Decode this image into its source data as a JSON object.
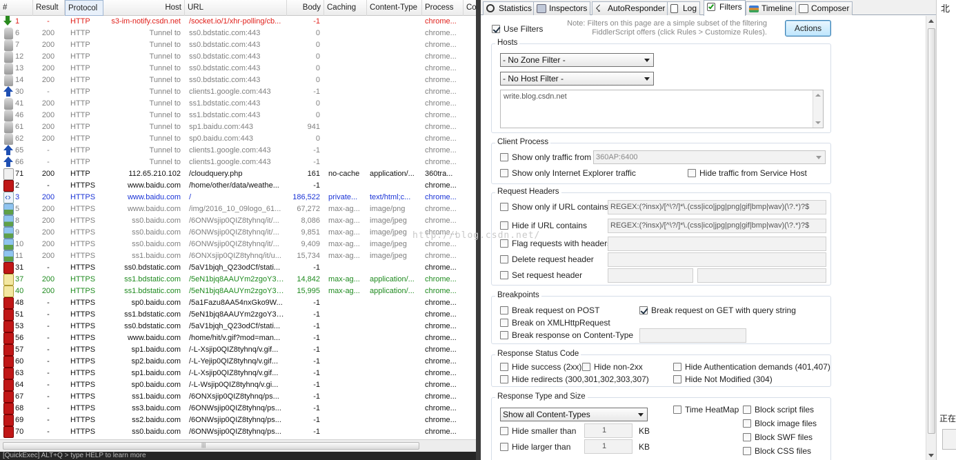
{
  "sessions": {
    "columns": {
      "num": "#",
      "result": "Result",
      "protocol": "Protocol",
      "host": "Host",
      "url": "URL",
      "body": "Body",
      "caching": "Caching",
      "content_type": "Content-Type",
      "process": "Process",
      "comments": "Co"
    },
    "rows": [
      {
        "icon": "arrowdown",
        "num": "1",
        "result": "-",
        "protocol": "HTTP",
        "host": "s3-im-notify.csdn.net",
        "url": "/socket.io/1/xhr-polling/cb...",
        "body": "-1",
        "caching": "",
        "ct": "",
        "process": "chrome...",
        "color": "red"
      },
      {
        "icon": "lock",
        "num": "6",
        "result": "200",
        "protocol": "HTTP",
        "host": "Tunnel to",
        "url": "ss0.bdstatic.com:443",
        "body": "0",
        "caching": "",
        "ct": "",
        "process": "chrome...",
        "color": "gray"
      },
      {
        "icon": "lock",
        "num": "7",
        "result": "200",
        "protocol": "HTTP",
        "host": "Tunnel to",
        "url": "ss0.bdstatic.com:443",
        "body": "0",
        "caching": "",
        "ct": "",
        "process": "chrome...",
        "color": "gray"
      },
      {
        "icon": "lock",
        "num": "12",
        "result": "200",
        "protocol": "HTTP",
        "host": "Tunnel to",
        "url": "ss0.bdstatic.com:443",
        "body": "0",
        "caching": "",
        "ct": "",
        "process": "chrome...",
        "color": "gray"
      },
      {
        "icon": "lock",
        "num": "13",
        "result": "200",
        "protocol": "HTTP",
        "host": "Tunnel to",
        "url": "ss0.bdstatic.com:443",
        "body": "0",
        "caching": "",
        "ct": "",
        "process": "chrome...",
        "color": "gray"
      },
      {
        "icon": "lock",
        "num": "14",
        "result": "200",
        "protocol": "HTTP",
        "host": "Tunnel to",
        "url": "ss0.bdstatic.com:443",
        "body": "0",
        "caching": "",
        "ct": "",
        "process": "chrome...",
        "color": "gray"
      },
      {
        "icon": "arrowup",
        "num": "30",
        "result": "-",
        "protocol": "HTTP",
        "host": "Tunnel to",
        "url": "clients1.google.com:443",
        "body": "-1",
        "caching": "",
        "ct": "",
        "process": "chrome...",
        "color": "gray"
      },
      {
        "icon": "lock",
        "num": "41",
        "result": "200",
        "protocol": "HTTP",
        "host": "Tunnel to",
        "url": "ss1.bdstatic.com:443",
        "body": "0",
        "caching": "",
        "ct": "",
        "process": "chrome...",
        "color": "gray"
      },
      {
        "icon": "lock",
        "num": "46",
        "result": "200",
        "protocol": "HTTP",
        "host": "Tunnel to",
        "url": "ss1.bdstatic.com:443",
        "body": "0",
        "caching": "",
        "ct": "",
        "process": "chrome...",
        "color": "gray"
      },
      {
        "icon": "lock",
        "num": "61",
        "result": "200",
        "protocol": "HTTP",
        "host": "Tunnel to",
        "url": "sp1.baidu.com:443",
        "body": "941",
        "caching": "",
        "ct": "",
        "process": "chrome...",
        "color": "gray"
      },
      {
        "icon": "lock",
        "num": "62",
        "result": "200",
        "protocol": "HTTP",
        "host": "Tunnel to",
        "url": "sp0.baidu.com:443",
        "body": "0",
        "caching": "",
        "ct": "",
        "process": "chrome...",
        "color": "gray"
      },
      {
        "icon": "arrowup",
        "num": "65",
        "result": "-",
        "protocol": "HTTP",
        "host": "Tunnel to",
        "url": "clients1.google.com:443",
        "body": "-1",
        "caching": "",
        "ct": "",
        "process": "chrome...",
        "color": "gray"
      },
      {
        "icon": "arrowup",
        "num": "66",
        "result": "-",
        "protocol": "HTTP",
        "host": "Tunnel to",
        "url": "clients1.google.com:443",
        "body": "-1",
        "caching": "",
        "ct": "",
        "process": "chrome...",
        "color": "gray"
      },
      {
        "icon": "json",
        "num": "71",
        "result": "200",
        "protocol": "HTTP",
        "host": "112.65.210.102",
        "url": "/cloudquery.php",
        "body": "161",
        "caching": "no-cache",
        "ct": "application/...",
        "process": "360tra...",
        "color": "black"
      },
      {
        "icon": "redx",
        "num": "2",
        "result": "-",
        "protocol": "HTTPS",
        "host": "www.baidu.com",
        "url": "/home/other/data/weathe...",
        "body": "-1",
        "caching": "",
        "ct": "",
        "process": "chrome...",
        "color": "black"
      },
      {
        "icon": "html",
        "num": "3",
        "result": "200",
        "protocol": "HTTPS",
        "host": "www.baidu.com",
        "url": "/",
        "body": "186,522",
        "caching": "private...",
        "ct": "text/html;c...",
        "process": "chrome...",
        "color": "blue"
      },
      {
        "icon": "image",
        "num": "5",
        "result": "200",
        "protocol": "HTTPS",
        "host": "www.baidu.com",
        "url": "/img/2016_10_09logo_61...",
        "body": "67,272",
        "caching": "max-ag...",
        "ct": "image/png",
        "process": "chrome...",
        "color": "gray"
      },
      {
        "icon": "image",
        "num": "8",
        "result": "200",
        "protocol": "HTTPS",
        "host": "ss0.baidu.com",
        "url": "/6ONWsjip0QIZ8tyhnq/it/...",
        "body": "8,086",
        "caching": "max-ag...",
        "ct": "image/jpeg",
        "process": "chrome...",
        "color": "gray"
      },
      {
        "icon": "image",
        "num": "9",
        "result": "200",
        "protocol": "HTTPS",
        "host": "ss0.baidu.com",
        "url": "/6ONWsjip0QIZ8tyhnq/it/...",
        "body": "9,851",
        "caching": "max-ag...",
        "ct": "image/jpeg",
        "process": "chrome...",
        "color": "gray"
      },
      {
        "icon": "image",
        "num": "10",
        "result": "200",
        "protocol": "HTTPS",
        "host": "ss0.baidu.com",
        "url": "/6ONWsjip0QIZ8tyhnq/it/...",
        "body": "9,409",
        "caching": "max-ag...",
        "ct": "image/jpeg",
        "process": "chrome...",
        "color": "gray"
      },
      {
        "icon": "image",
        "num": "11",
        "result": "200",
        "protocol": "HTTPS",
        "host": "ss1.baidu.com",
        "url": "/6ONXsjip0QIZ8tyhnq/it/u...",
        "body": "15,734",
        "caching": "max-ag...",
        "ct": "image/jpeg",
        "process": "chrome...",
        "color": "gray"
      },
      {
        "icon": "redx",
        "num": "31",
        "result": "-",
        "protocol": "HTTPS",
        "host": "ss0.bdstatic.com",
        "url": "/5aV1bjqh_Q23odCf/stati...",
        "body": "-1",
        "caching": "",
        "ct": "",
        "process": "chrome...",
        "color": "black"
      },
      {
        "icon": "script",
        "num": "37",
        "result": "200",
        "protocol": "HTTPS",
        "host": "ss1.bdstatic.com",
        "url": "/5eN1bjq8AAUYm2zgoY3K...",
        "body": "14,842",
        "caching": "max-ag...",
        "ct": "application/...",
        "process": "chrome...",
        "color": "green"
      },
      {
        "icon": "script",
        "num": "40",
        "result": "200",
        "protocol": "HTTPS",
        "host": "ss1.bdstatic.com",
        "url": "/5eN1bjq8AAUYm2zgoY3K...",
        "body": "15,995",
        "caching": "max-ag...",
        "ct": "application/...",
        "process": "chrome...",
        "color": "green"
      },
      {
        "icon": "redx",
        "num": "48",
        "result": "-",
        "protocol": "HTTPS",
        "host": "sp0.baidu.com",
        "url": "/5a1Fazu8AA54nxGko9W...",
        "body": "-1",
        "caching": "",
        "ct": "",
        "process": "chrome...",
        "color": "black"
      },
      {
        "icon": "redx",
        "num": "51",
        "result": "-",
        "protocol": "HTTPS",
        "host": "ss1.bdstatic.com",
        "url": "/5eN1bjq8AAUYm2zgoY3K...",
        "body": "-1",
        "caching": "",
        "ct": "",
        "process": "chrome...",
        "color": "black"
      },
      {
        "icon": "redx",
        "num": "53",
        "result": "-",
        "protocol": "HTTPS",
        "host": "ss0.bdstatic.com",
        "url": "/5aV1bjqh_Q23odCf/stati...",
        "body": "-1",
        "caching": "",
        "ct": "",
        "process": "chrome...",
        "color": "black"
      },
      {
        "icon": "redx",
        "num": "56",
        "result": "-",
        "protocol": "HTTPS",
        "host": "www.baidu.com",
        "url": "/home/hit/v.gif?mod=man...",
        "body": "-1",
        "caching": "",
        "ct": "",
        "process": "chrome...",
        "color": "black"
      },
      {
        "icon": "redx",
        "num": "57",
        "result": "-",
        "protocol": "HTTPS",
        "host": "sp1.baidu.com",
        "url": "/-L-Xsjip0QIZ8tyhnq/v.gif...",
        "body": "-1",
        "caching": "",
        "ct": "",
        "process": "chrome...",
        "color": "black"
      },
      {
        "icon": "redx",
        "num": "60",
        "result": "-",
        "protocol": "HTTPS",
        "host": "sp2.baidu.com",
        "url": "/-L-Yejip0QIZ8tyhnq/v.gif...",
        "body": "-1",
        "caching": "",
        "ct": "",
        "process": "chrome...",
        "color": "black"
      },
      {
        "icon": "redx",
        "num": "63",
        "result": "-",
        "protocol": "HTTPS",
        "host": "sp1.baidu.com",
        "url": "/-L-Xsjip0QIZ8tyhnq/v.gif...",
        "body": "-1",
        "caching": "",
        "ct": "",
        "process": "chrome...",
        "color": "black"
      },
      {
        "icon": "redx",
        "num": "64",
        "result": "-",
        "protocol": "HTTPS",
        "host": "sp0.baidu.com",
        "url": "/-L-Wsjip0QIZ8tyhnq/v.gi...",
        "body": "-1",
        "caching": "",
        "ct": "",
        "process": "chrome...",
        "color": "black"
      },
      {
        "icon": "redx",
        "num": "67",
        "result": "-",
        "protocol": "HTTPS",
        "host": "ss1.baidu.com",
        "url": "/6ONXsjip0QIZ8tyhnq/ps...",
        "body": "-1",
        "caching": "",
        "ct": "",
        "process": "chrome...",
        "color": "black"
      },
      {
        "icon": "redx",
        "num": "68",
        "result": "-",
        "protocol": "HTTPS",
        "host": "ss3.baidu.com",
        "url": "/6ONWsjip0QIZ8tyhnq/ps...",
        "body": "-1",
        "caching": "",
        "ct": "",
        "process": "chrome...",
        "color": "black"
      },
      {
        "icon": "redx",
        "num": "69",
        "result": "-",
        "protocol": "HTTPS",
        "host": "ss2.baidu.com",
        "url": "/6ONWsjip0QIZ8tyhnq/ps...",
        "body": "-1",
        "caching": "",
        "ct": "",
        "process": "chrome...",
        "color": "black"
      },
      {
        "icon": "redx",
        "num": "70",
        "result": "-",
        "protocol": "HTTPS",
        "host": "ss0.baidu.com",
        "url": "/6ONWsjip0QIZ8tyhnq/ps...",
        "body": "-1",
        "caching": "",
        "ct": "",
        "process": "chrome...",
        "color": "black"
      }
    ]
  },
  "quickexec": "[QuickExec] ALT+Q > type HELP to learn more",
  "tabs": {
    "statistics": "Statistics",
    "inspectors": "Inspectors",
    "autoresponder": "AutoResponder",
    "log": "Log",
    "filters": "Filters",
    "timeline": "Timeline",
    "composer": "Composer"
  },
  "filters": {
    "use_filters": "Use Filters",
    "note": "Note: Filters on this page are a simple subset of the filtering FiddlerScript offers (click Rules > Customize Rules).",
    "actions": "Actions",
    "hosts": {
      "legend": "Hosts",
      "zone_filter": "- No Zone Filter -",
      "host_filter": "- No Host Filter -",
      "host_list": "write.blog.csdn.net"
    },
    "client_process": {
      "legend": "Client Process",
      "show_only_traffic_from": "Show only traffic from",
      "process_value": "360AP:6400",
      "show_only_ie": "Show only Internet Explorer traffic",
      "hide_service_host": "Hide traffic from Service Host"
    },
    "request_headers": {
      "legend": "Request Headers",
      "show_if_url": "Show only if URL contains",
      "show_if_url_value": "REGEX:(?insx)/[^\\?/]*\\.(css|ico|jpg|png|gif|bmp|wav)(\\?.*)?$",
      "hide_if_url": "Hide if URL contains",
      "hide_if_url_value": "REGEX:(?insx)/[^\\?/]*\\.(css|ico|jpg|png|gif|bmp|wav)(\\?.*)?$",
      "flag_with_headers": "Flag requests with headers",
      "delete_header": "Delete request header",
      "set_header": "Set request header"
    },
    "breakpoints": {
      "legend": "Breakpoints",
      "post": "Break request on POST",
      "get_query": "Break request on GET with query string",
      "xhr": "Break on XMLHttpRequest",
      "content_type": "Break response on Content-Type"
    },
    "status_code": {
      "legend": "Response Status Code",
      "hide_success": "Hide success (2xx)",
      "hide_non2xx": "Hide non-2xx",
      "hide_auth": "Hide Authentication demands (401,407)",
      "hide_redirects": "Hide redirects (300,301,302,303,307)",
      "hide_not_modified": "Hide Not Modified (304)"
    },
    "type_size": {
      "legend": "Response Type and Size",
      "content_types": "Show all Content-Types",
      "time_heatmap": "Time HeatMap",
      "block_script": "Block script files",
      "block_image": "Block image files",
      "block_swf": "Block SWF files",
      "block_css": "Block CSS files",
      "hide_smaller": "Hide smaller than",
      "hide_larger": "Hide larger than",
      "smaller_value": "1",
      "larger_value": "1",
      "kb": "KB"
    }
  },
  "watermark": "http://blog.csdn.net/",
  "far_right": {
    "top": "北",
    "bottom": "正在"
  },
  "colors": {
    "red": "#e0201b",
    "blue": "#1a33d6",
    "green": "#1e8a1e",
    "gray": "#808080"
  }
}
